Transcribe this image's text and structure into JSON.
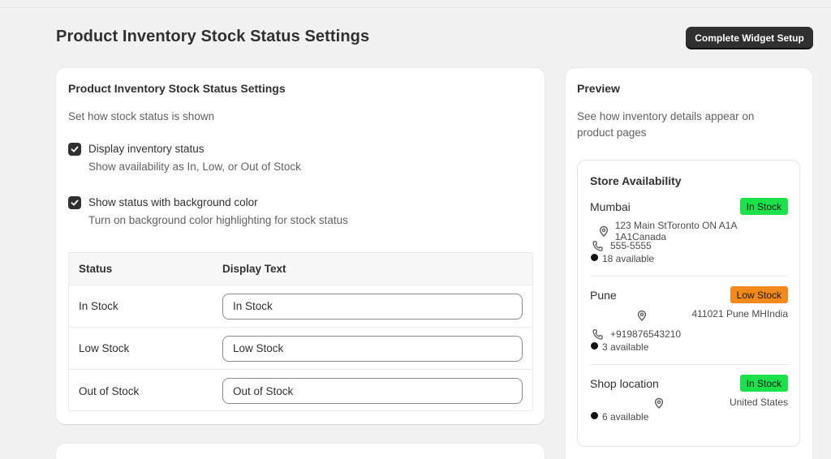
{
  "page": {
    "title": "Product Inventory Stock Status Settings",
    "primary_action": "Complete Widget Setup"
  },
  "settings": {
    "title": "Product Inventory Stock Status Settings",
    "subtitle": "Set how stock status is shown",
    "options": [
      {
        "label": "Display inventory status",
        "help": "Show availability as In, Low, or Out of Stock",
        "checked": true
      },
      {
        "label": "Show status with background color",
        "help": "Turn on background color highlighting for stock status",
        "checked": true
      }
    ],
    "table": {
      "headers": [
        "Status",
        "Display Text"
      ],
      "rows": [
        {
          "status": "In Stock",
          "display_text": "In Stock"
        },
        {
          "status": "Low Stock",
          "display_text": "Low Stock"
        },
        {
          "status": "Out of Stock",
          "display_text": "Out of Stock"
        }
      ]
    }
  },
  "preview": {
    "title": "Preview",
    "description": "See how inventory details appear on product pages",
    "widget_title": "Store Availability",
    "stores": [
      {
        "name": "Mumbai",
        "badge": "In Stock",
        "badge_color": "#1be24b",
        "address": "123 Main StToronto ON A1A 1A1Canada",
        "phone": "555-5555",
        "available": "18 available"
      },
      {
        "name": "Pune",
        "badge": "Low Stock",
        "badge_color": "#f3891b",
        "address": "411021 Pune MHIndia",
        "phone": "+919876543210",
        "available": "3 available"
      },
      {
        "name": "Shop location",
        "badge": "In Stock",
        "badge_color": "#1be24b",
        "address": "United States",
        "available": "6 available"
      }
    ]
  },
  "colors": {
    "background": "#f1f1f1",
    "primary_button": "#303030",
    "in_stock": "#1be24b",
    "low_stock": "#f3891b"
  }
}
